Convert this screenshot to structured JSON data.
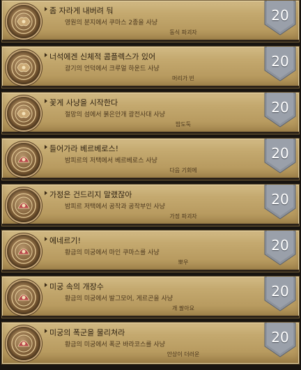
{
  "achievements": [
    {
      "title": "좀 자라게 내버려 둬",
      "description": "영원의 분지에서 쿠마스 2종을 사냥",
      "reward": "동식 파괴자",
      "points": "20"
    },
    {
      "title": "너석에겐 신체적 콤플렉스가 있어",
      "description": "광기의 언덕에서 크루얼 하운드 사냥",
      "reward": "머리가 빈",
      "points": "20"
    },
    {
      "title": "꽃게 사냥을 시작한다",
      "description": "절망의 섬에서 붉은안개 광전사대 사냥",
      "reward": "밥도둑",
      "points": "20"
    },
    {
      "title": "들어가라 베르베로스!",
      "description": "밤피르의 저택에서 베르베로스 사냥",
      "reward": "다음 기회에",
      "points": "20"
    },
    {
      "title": "가정은 건드리지 말랬잖아",
      "description": "밤피르 저택에서 공작과 공작부인 사냥",
      "reward": "가정 파괴자",
      "points": "20"
    },
    {
      "title": "에네르기!",
      "description": "황금의 미궁에서 마인 쿠마스를 사냥",
      "reward": "뽀우",
      "points": "20"
    },
    {
      "title": "미궁 속의 개장수",
      "description": "황금의 미궁에서 발그모어, 게르곤을 사냥",
      "reward": "개 팔아요",
      "points": "20"
    },
    {
      "title": "미궁의 폭군을 물리쳐라",
      "description": "황금의 미궁에서 폭군 바라코스를 사냥",
      "reward": "안상이 더러운",
      "points": "20"
    }
  ]
}
